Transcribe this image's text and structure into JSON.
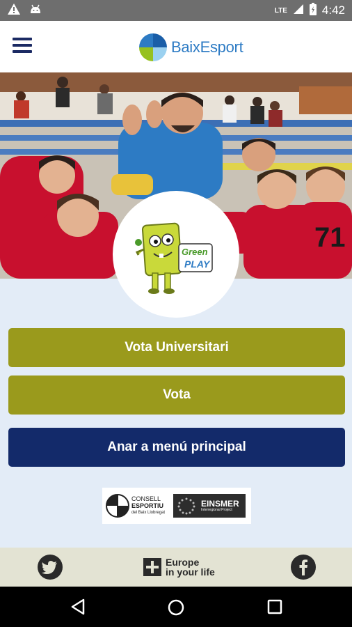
{
  "status_bar": {
    "network": "LTE",
    "time": "4:42",
    "icons": [
      "warning-icon",
      "android-icon",
      "signal-icon",
      "battery-icon"
    ]
  },
  "app_bar": {
    "logo_text": "BaixEsport",
    "menu_icon": "hamburger-menu-icon"
  },
  "hero": {
    "badge": {
      "line1": "Green",
      "line2": "PLAY"
    }
  },
  "buttons": {
    "vote_university": "Vota Universitari",
    "vote": "Vota",
    "main_menu": "Anar a menú principal"
  },
  "partners": {
    "consell_line1": "CONSELL",
    "consell_line2": "ESPORTIU",
    "consell_line3": "del Baix Llobregat",
    "einsmer_name": "EINSMER",
    "einsmer_sub": "Interregional Project"
  },
  "footer": {
    "europe_line1": "Europe",
    "europe_line2": "in your life",
    "icons": [
      "twitter-icon",
      "facebook-icon"
    ]
  },
  "colors": {
    "olive": "#9a9a1c",
    "navy": "#132a6a",
    "brand_blue": "#2d7bc4",
    "status_bar": "#6e6e6e"
  }
}
